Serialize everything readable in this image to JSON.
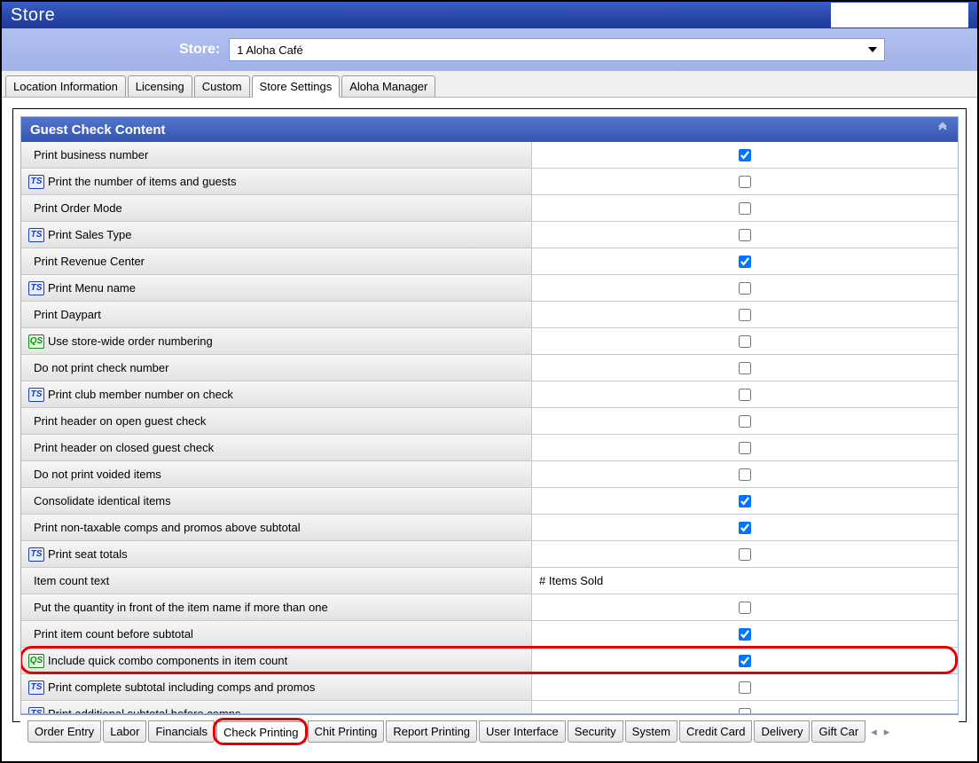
{
  "title": "Store",
  "storeLabel": "Store:",
  "storeValue": "1 Aloha Café",
  "topTabs": [
    "Location Information",
    "Licensing",
    "Custom",
    "Store Settings",
    "Aloha Manager"
  ],
  "topTabActive": 3,
  "sectionTitle": "Guest Check Content",
  "rows": [
    {
      "label": "Print business number",
      "prefix": null,
      "type": "check",
      "checked": true
    },
    {
      "label": "Print the number of items and guests",
      "prefix": "TS",
      "type": "check",
      "checked": false
    },
    {
      "label": "Print Order Mode",
      "prefix": null,
      "type": "check",
      "checked": false
    },
    {
      "label": "Print Sales Type",
      "prefix": "TS",
      "type": "check",
      "checked": false
    },
    {
      "label": "Print Revenue Center",
      "prefix": null,
      "type": "check",
      "checked": true
    },
    {
      "label": "Print Menu name",
      "prefix": "TS",
      "type": "check",
      "checked": false
    },
    {
      "label": "Print Daypart",
      "prefix": null,
      "type": "check",
      "checked": false
    },
    {
      "label": "Use store-wide order numbering",
      "prefix": "QS",
      "type": "check",
      "checked": false
    },
    {
      "label": "Do not print check number",
      "prefix": null,
      "type": "check",
      "checked": false
    },
    {
      "label": "Print club member number on check",
      "prefix": "TS",
      "type": "check",
      "checked": false
    },
    {
      "label": "Print header on open guest check",
      "prefix": null,
      "type": "check",
      "checked": false
    },
    {
      "label": "Print header on closed guest check",
      "prefix": null,
      "type": "check",
      "checked": false
    },
    {
      "label": "Do not print voided items",
      "prefix": null,
      "type": "check",
      "checked": false
    },
    {
      "label": "Consolidate identical items",
      "prefix": null,
      "type": "check",
      "checked": true
    },
    {
      "label": "Print non-taxable comps and promos above subtotal",
      "prefix": null,
      "type": "check",
      "checked": true
    },
    {
      "label": "Print seat totals",
      "prefix": "TS",
      "type": "check",
      "checked": false
    },
    {
      "label": "Item count text",
      "prefix": null,
      "type": "text",
      "value": "# Items Sold"
    },
    {
      "label": "Put the quantity in front of the item name if more than one",
      "prefix": null,
      "type": "check",
      "checked": false
    },
    {
      "label": "Print item count before subtotal",
      "prefix": null,
      "type": "check",
      "checked": true
    },
    {
      "label": "Include quick combo components in item count",
      "prefix": "QS",
      "type": "check",
      "checked": true
    },
    {
      "label": "Print complete subtotal including comps and promos",
      "prefix": "TS",
      "type": "check",
      "checked": false
    },
    {
      "label": "Print additional subtotal before comps",
      "prefix": "TS",
      "type": "check",
      "checked": false
    }
  ],
  "highlightRowIndex": 19,
  "bottomTabs": [
    "Order Entry",
    "Labor",
    "Financials",
    "Check Printing",
    "Chit Printing",
    "Report Printing",
    "User Interface",
    "Security",
    "System",
    "Credit Card",
    "Delivery",
    "Gift Car"
  ],
  "bottomTabActive": 3,
  "bottomHighlightIndex": 3
}
